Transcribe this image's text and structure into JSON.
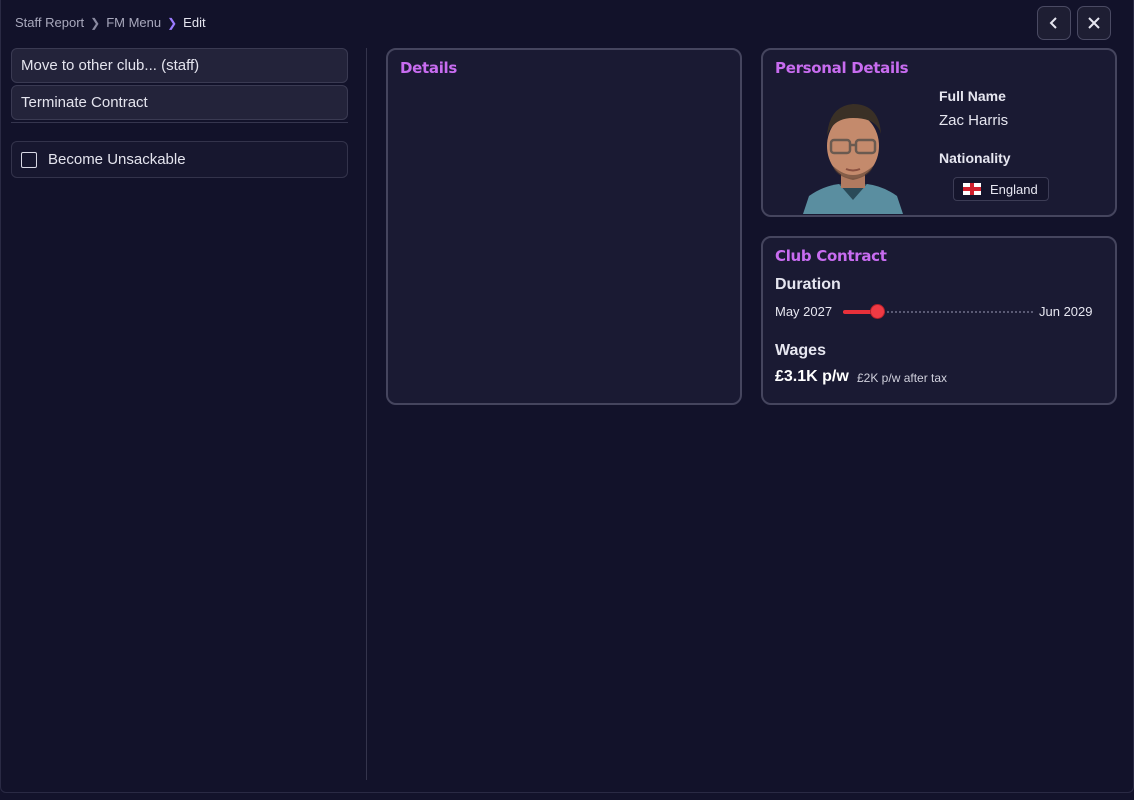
{
  "breadcrumb": {
    "items": [
      "Staff Report",
      "FM Menu"
    ],
    "current": "Edit"
  },
  "actions": {
    "move_label": "Move to other club... (staff)",
    "terminate_label": "Terminate Contract",
    "unsackable_label": "Become Unsackable",
    "unsackable_checked": false
  },
  "details": {
    "title": "Details"
  },
  "personal": {
    "title": "Personal Details",
    "full_name_label": "Full Name",
    "full_name": "Zac Harris",
    "nationality_label": "Nationality",
    "nationality": "England"
  },
  "contract": {
    "title": "Club Contract",
    "duration_label": "Duration",
    "start": "May 2027",
    "end": "Jun 2029",
    "progress_fraction": 0.18,
    "wages_label": "Wages",
    "wage": "£3.1K p/w",
    "wage_after_tax": "£2K p/w after tax"
  },
  "icons": {
    "back": "chevron-left-icon",
    "close": "close-icon",
    "flag": "england-flag-icon"
  },
  "colors": {
    "accent": "#c86cf0",
    "slider": "#e8303a",
    "background": "#12122a"
  }
}
